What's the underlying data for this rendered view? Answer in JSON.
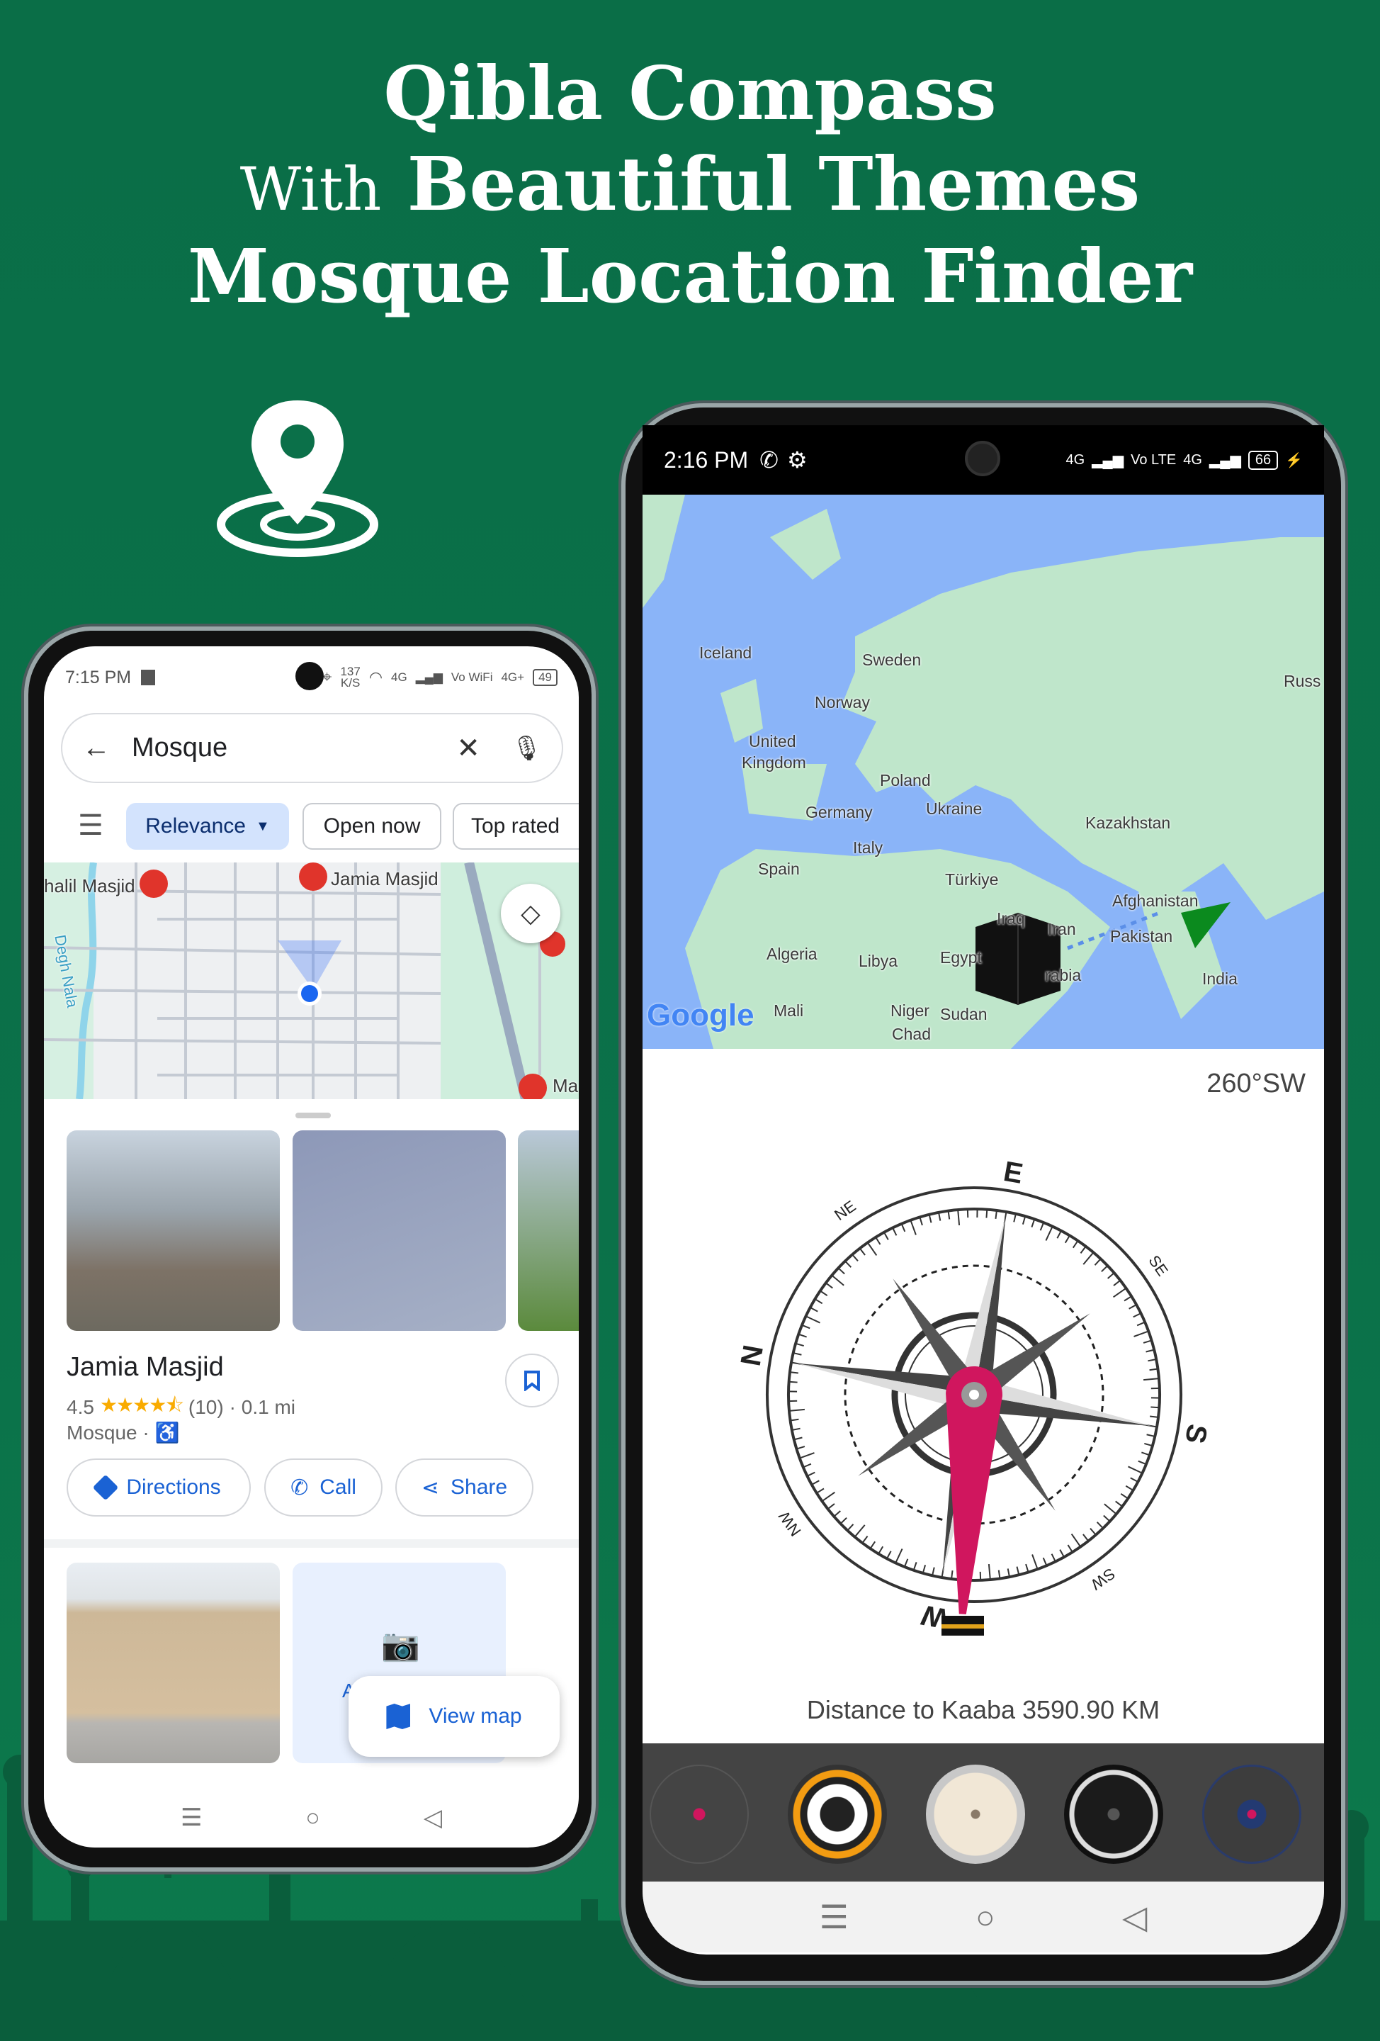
{
  "headline": {
    "line1": "Qibla Compass",
    "line2_prefix": "With",
    "line2_main": "Beautiful Themes",
    "line3": "Mosque Location Finder"
  },
  "colors": {
    "background": "#0b7049",
    "accent_blue": "#1a62d4",
    "needle": "#d0165e",
    "theme_strip": "#444444"
  },
  "left_phone": {
    "status": {
      "time": "7:15 PM",
      "speed": "137",
      "speed_unit": "K/S",
      "net1": "4G",
      "volte": "Vo WiFi",
      "net2": "4G+",
      "battery": "49"
    },
    "search": {
      "value": "Mosque",
      "back_icon": "arrow-left",
      "clear_icon": "close",
      "mic_icon": "mic"
    },
    "filters": {
      "filter_icon": "tune",
      "chips": [
        "Relevance",
        "Open now",
        "Top rated"
      ]
    },
    "map": {
      "labels": [
        "halil Masjid",
        "Jamia Masjid",
        "Degh Nala",
        "Ma"
      ]
    },
    "result": {
      "name": "Jamia Masjid",
      "rating": "4.5",
      "rating_value": 4.5,
      "reviews": "(10)",
      "distance": "· 0.1 mi",
      "category": "Mosque ·",
      "buttons": [
        "Directions",
        "Call",
        "Share"
      ]
    },
    "second": {
      "add_photo_partial": "A",
      "view_map": "View map"
    }
  },
  "right_phone": {
    "status": {
      "time": "2:16 PM",
      "net1": "4G",
      "volte": "Vo LTE",
      "net2": "4G",
      "battery": "66"
    },
    "map": {
      "labels": [
        "Iceland",
        "Sweden",
        "Norway",
        "United",
        "Kingdom",
        "Poland",
        "Germany",
        "Ukraine",
        "Kazakhstan",
        "Spain",
        "Italy",
        "Türkiye",
        "Iraq",
        "Iran",
        "Afghanistan",
        "Pakistan",
        "Algeria",
        "Libya",
        "Egypt",
        "rabia",
        "India",
        "Mali",
        "Niger",
        "Sudan",
        "Chad",
        "Russ"
      ],
      "logo": "Google"
    },
    "heading": "260°SW",
    "compass": {
      "labels": [
        "N",
        "NE",
        "E",
        "SE",
        "S",
        "SW",
        "W",
        "NW"
      ]
    },
    "distance": "Distance to Kaaba 3590.90 KM",
    "themes": [
      "classic",
      "orange",
      "vintage",
      "black",
      "navy"
    ]
  }
}
